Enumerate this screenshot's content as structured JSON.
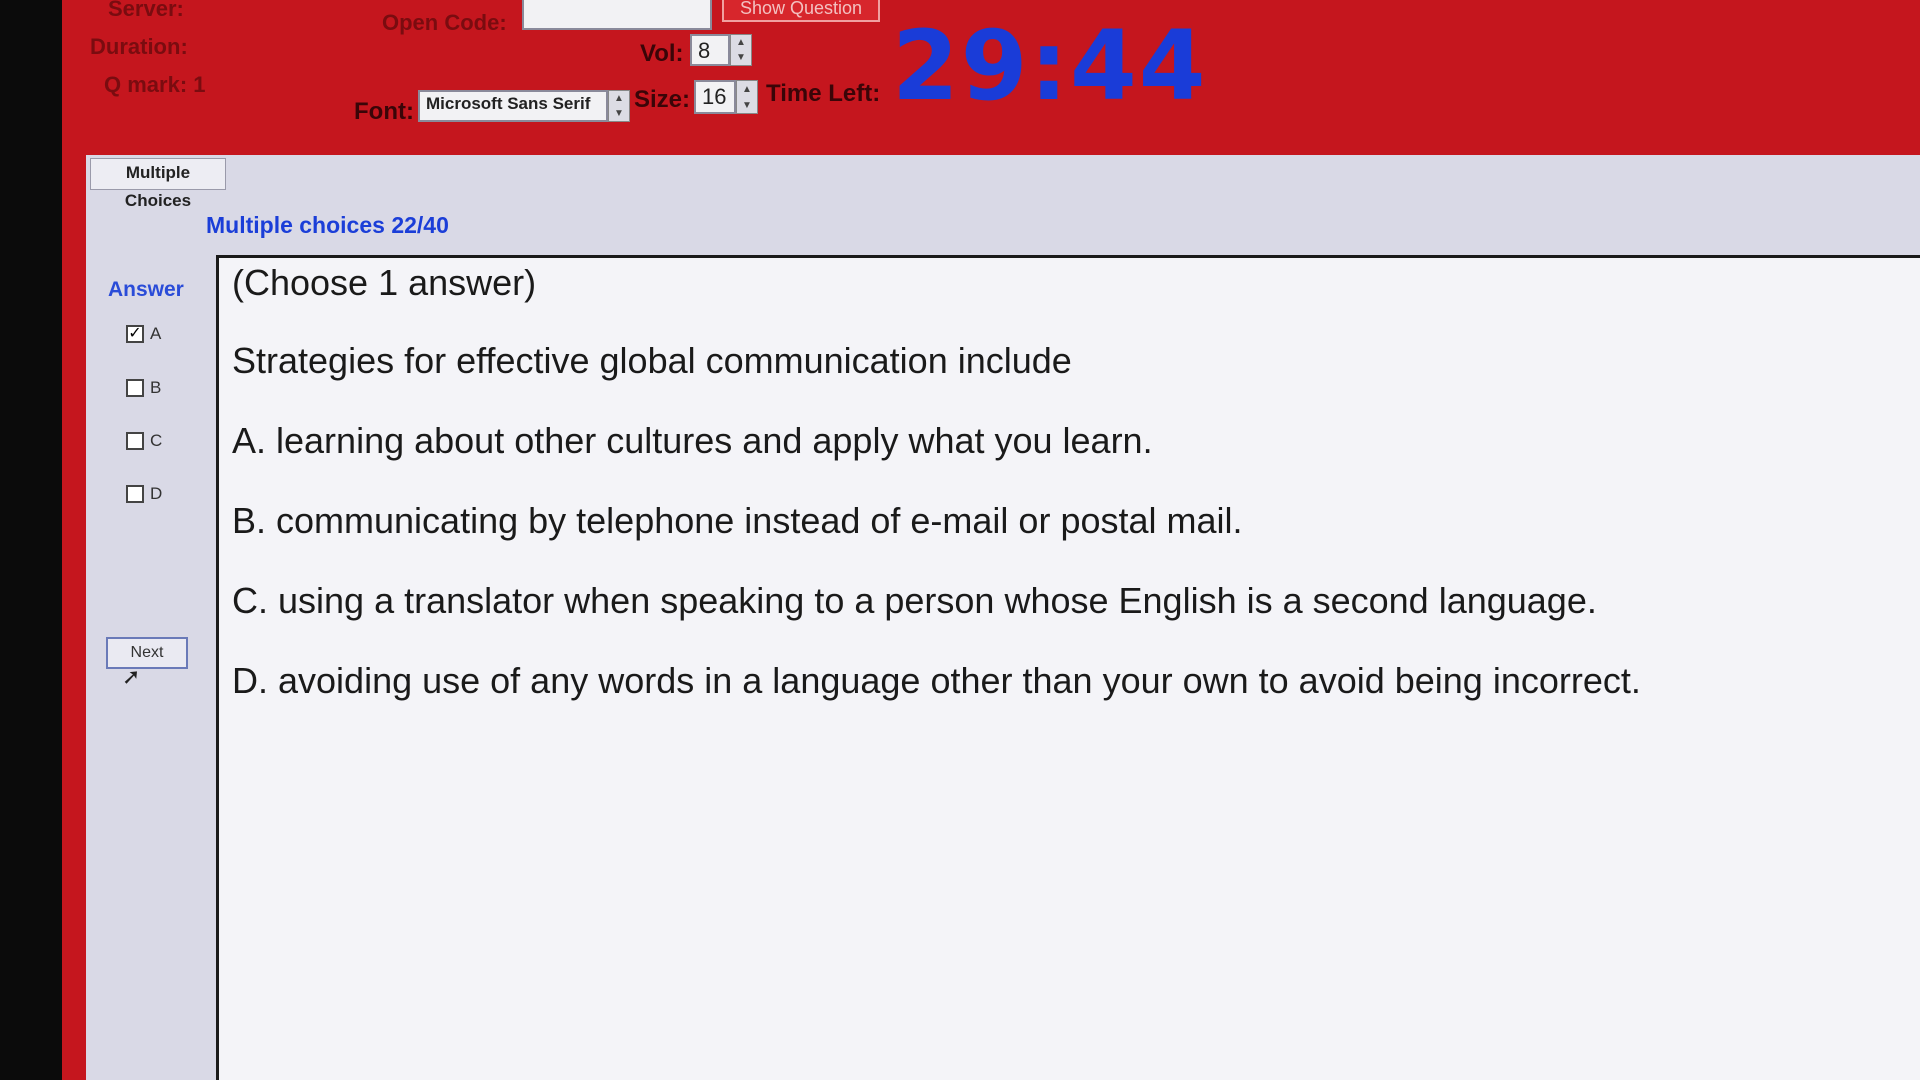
{
  "header": {
    "server_label": "Server:",
    "duration_label": "Duration:",
    "qmark_label": "Q mark:",
    "qmark_value": "1",
    "open_code_label": "Open Code:",
    "open_code_value": "",
    "show_question_label": "Show Question",
    "vol_label": "Vol:",
    "vol_value": "8",
    "font_label": "Font:",
    "font_value": "Microsoft Sans Serif",
    "size_label": "Size:",
    "size_value": "16",
    "time_left_label": "Time Left:",
    "time_left_value": "29:44"
  },
  "tab": {
    "label": "Multiple Choices"
  },
  "progress": {
    "label": "Multiple choices 22/40",
    "current": 22,
    "total": 40
  },
  "answer": {
    "title": "Answer",
    "options": [
      {
        "label": "A",
        "checked": true
      },
      {
        "label": "B",
        "checked": false
      },
      {
        "label": "C",
        "checked": false
      },
      {
        "label": "D",
        "checked": false
      }
    ],
    "next_label": "Next"
  },
  "question": {
    "instruction": "(Choose 1 answer)",
    "stem": "Strategies for effective global communication include",
    "choices": [
      "A.  learning about other cultures and apply what you learn.",
      "B.  communicating by telephone instead of e-mail or postal mail.",
      "C.  using a translator when speaking to a person whose English is a second language.",
      "D.  avoiding use of any words in a language other than your own to avoid being incorrect."
    ]
  },
  "colors": {
    "header_bg": "#c5161e",
    "timer": "#1a3cd8",
    "accent_blue": "#1b3ed8"
  },
  "icons": {
    "checkbox_checked": "check-icon",
    "cursor": "mouse-pointer-icon"
  }
}
